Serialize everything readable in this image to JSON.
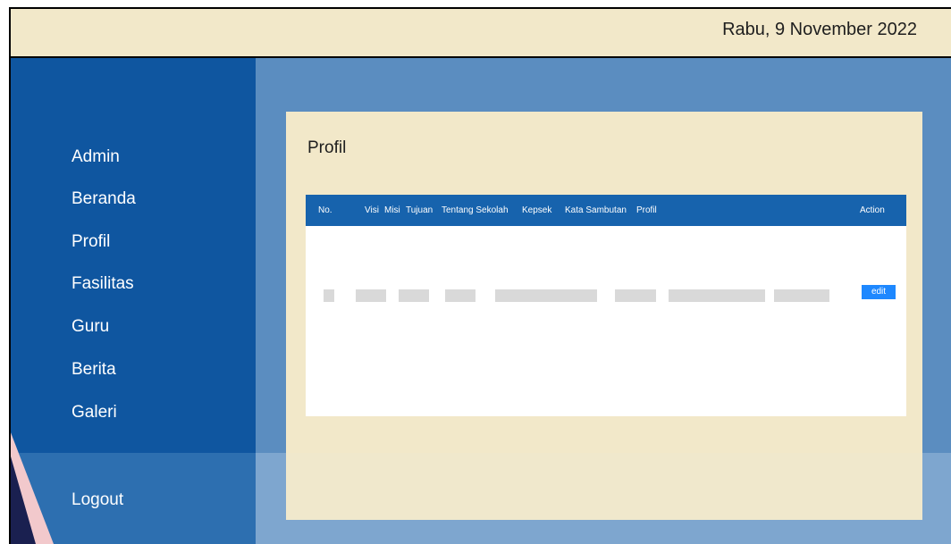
{
  "header": {
    "date": "Rabu, 9 November 2022"
  },
  "sidebar": {
    "items": [
      {
        "label": "Admin"
      },
      {
        "label": "Beranda"
      },
      {
        "label": "Profil"
      },
      {
        "label": "Fasilitas"
      },
      {
        "label": "Guru"
      },
      {
        "label": "Berita"
      },
      {
        "label": "Galeri"
      }
    ],
    "logout": "Logout"
  },
  "main": {
    "title": "Profil",
    "table": {
      "columns": [
        "No.",
        "Visi",
        "Misi",
        "Tujuan",
        "Tentang Sekolah",
        "Kepsek",
        "Kata Sambutan",
        "Profil",
        "Action"
      ],
      "edit_label": "edit"
    }
  },
  "colors": {
    "header_bg": "#f2e8c9",
    "sidebar_bg": "#0f56a0",
    "main_bg": "#5b8dc0",
    "table_header_bg": "#1763ad",
    "edit_button": "#1e88ff"
  }
}
